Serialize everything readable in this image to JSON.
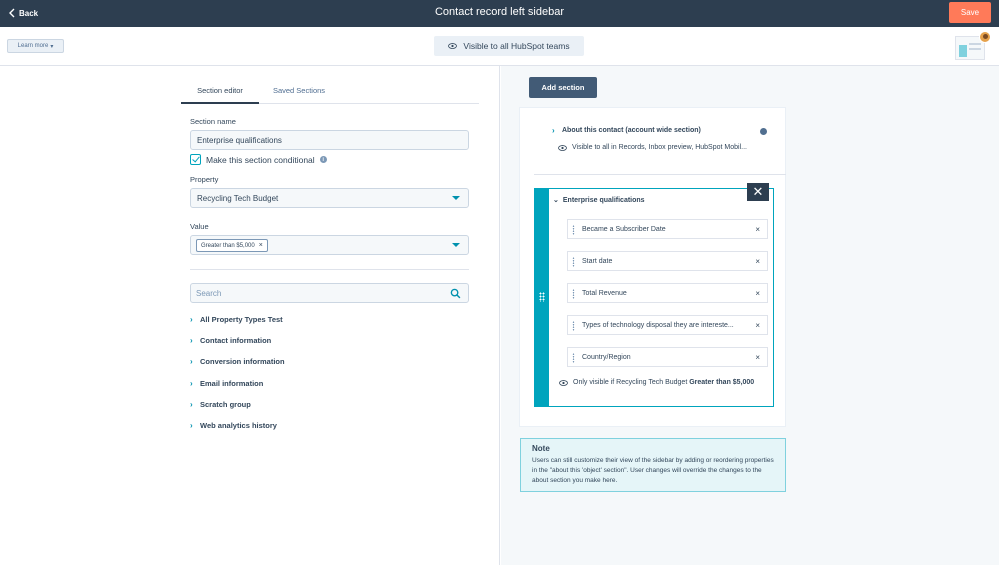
{
  "topbar": {
    "back_label": "Back",
    "title": "Contact record left sidebar",
    "save_label": "Save"
  },
  "subbar": {
    "learn_more_label": "Learn more",
    "visibility_label": "Visible to all HubSpot teams"
  },
  "tabs": [
    {
      "label": "Section editor",
      "active": true
    },
    {
      "label": "Saved Sections",
      "active": false
    }
  ],
  "form": {
    "section_name_label": "Section name",
    "section_name_value": "Enterprise qualifications",
    "conditional_label": "Make this section conditional",
    "conditional_checked": true,
    "property_label": "Property",
    "property_value": "Recycling Tech Budget",
    "value_label": "Value",
    "value_tag": "Greater than $5,000",
    "search_placeholder": "Search"
  },
  "property_groups": [
    "All Property Types Test",
    "Contact information",
    "Conversion information",
    "Email information",
    "Scratch group",
    "Web analytics history"
  ],
  "preview": {
    "add_section_label": "Add section",
    "about_title": "About this contact (account wide section)",
    "about_visibility": "Visible to all in Records, Inbox preview, HubSpot Mobil...",
    "section_title": "Enterprise qualifications",
    "properties": [
      "Became a Subscriber Date",
      "Start date",
      "Total Revenue",
      "Types of technology disposal they are intereste...",
      "Country/Region"
    ],
    "condition_prefix": "Only visible if Recycling Tech Budget",
    "condition_bold": "Greater than $5,000"
  },
  "note": {
    "title": "Note",
    "body": "Users can still customize their view of the sidebar by adding or reordering properties in the \"about this 'object' section\". User changes will override the changes to the about section you make here."
  },
  "colors": {
    "topbar": "#2d3e50",
    "accent": "#00a4bd",
    "save": "#ff7a59",
    "link": "#0091ae"
  }
}
